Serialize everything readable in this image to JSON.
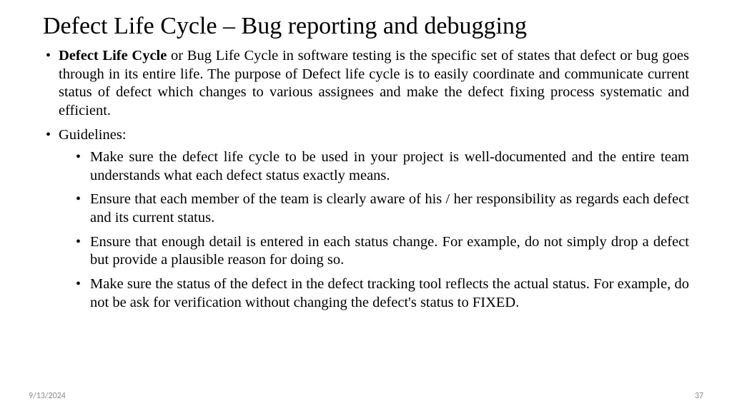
{
  "slide": {
    "title": "Defect Life Cycle – Bug reporting and debugging",
    "bullet1_lead": "Defect Life Cycle",
    "bullet1_rest": " or Bug Life Cycle in software testing is the specific set of states that defect or bug goes through in its entire life. The purpose of Defect life cycle is to easily coordinate and communicate current status of defect which changes to various assignees and make the defect fixing process systematic and efficient.",
    "bullet2": "Guidelines:",
    "sub1": "Make sure the defect life cycle to be used in your project is well-documented and the entire team understands what each defect status exactly means.",
    "sub2": "Ensure that each member of the team is clearly aware of his / her responsibility as regards each defect and its current status.",
    "sub3": "Ensure that enough detail is entered in each status change. For example, do not simply drop a defect but provide a plausible reason for doing so.",
    "sub4": "Make sure the status of the defect in the defect tracking tool reflects the actual status. For example, do not be ask for verification without changing the defect's status to FIXED."
  },
  "footer": {
    "date": "9/13/2024",
    "page": "37"
  }
}
